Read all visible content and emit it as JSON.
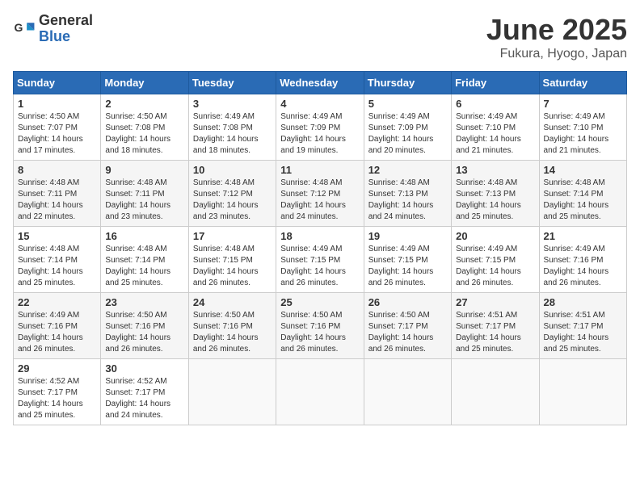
{
  "header": {
    "logo_general": "General",
    "logo_blue": "Blue",
    "month_title": "June 2025",
    "location": "Fukura, Hyogo, Japan"
  },
  "columns": [
    "Sunday",
    "Monday",
    "Tuesday",
    "Wednesday",
    "Thursday",
    "Friday",
    "Saturday"
  ],
  "weeks": [
    [
      {
        "day": "1",
        "sunrise": "4:50 AM",
        "sunset": "7:07 PM",
        "daylight": "14 hours and 17 minutes."
      },
      {
        "day": "2",
        "sunrise": "4:50 AM",
        "sunset": "7:08 PM",
        "daylight": "14 hours and 18 minutes."
      },
      {
        "day": "3",
        "sunrise": "4:49 AM",
        "sunset": "7:08 PM",
        "daylight": "14 hours and 18 minutes."
      },
      {
        "day": "4",
        "sunrise": "4:49 AM",
        "sunset": "7:09 PM",
        "daylight": "14 hours and 19 minutes."
      },
      {
        "day": "5",
        "sunrise": "4:49 AM",
        "sunset": "7:09 PM",
        "daylight": "14 hours and 20 minutes."
      },
      {
        "day": "6",
        "sunrise": "4:49 AM",
        "sunset": "7:10 PM",
        "daylight": "14 hours and 21 minutes."
      },
      {
        "day": "7",
        "sunrise": "4:49 AM",
        "sunset": "7:10 PM",
        "daylight": "14 hours and 21 minutes."
      }
    ],
    [
      {
        "day": "8",
        "sunrise": "4:48 AM",
        "sunset": "7:11 PM",
        "daylight": "14 hours and 22 minutes."
      },
      {
        "day": "9",
        "sunrise": "4:48 AM",
        "sunset": "7:11 PM",
        "daylight": "14 hours and 23 minutes."
      },
      {
        "day": "10",
        "sunrise": "4:48 AM",
        "sunset": "7:12 PM",
        "daylight": "14 hours and 23 minutes."
      },
      {
        "day": "11",
        "sunrise": "4:48 AM",
        "sunset": "7:12 PM",
        "daylight": "14 hours and 24 minutes."
      },
      {
        "day": "12",
        "sunrise": "4:48 AM",
        "sunset": "7:13 PM",
        "daylight": "14 hours and 24 minutes."
      },
      {
        "day": "13",
        "sunrise": "4:48 AM",
        "sunset": "7:13 PM",
        "daylight": "14 hours and 25 minutes."
      },
      {
        "day": "14",
        "sunrise": "4:48 AM",
        "sunset": "7:14 PM",
        "daylight": "14 hours and 25 minutes."
      }
    ],
    [
      {
        "day": "15",
        "sunrise": "4:48 AM",
        "sunset": "7:14 PM",
        "daylight": "14 hours and 25 minutes."
      },
      {
        "day": "16",
        "sunrise": "4:48 AM",
        "sunset": "7:14 PM",
        "daylight": "14 hours and 25 minutes."
      },
      {
        "day": "17",
        "sunrise": "4:48 AM",
        "sunset": "7:15 PM",
        "daylight": "14 hours and 26 minutes."
      },
      {
        "day": "18",
        "sunrise": "4:49 AM",
        "sunset": "7:15 PM",
        "daylight": "14 hours and 26 minutes."
      },
      {
        "day": "19",
        "sunrise": "4:49 AM",
        "sunset": "7:15 PM",
        "daylight": "14 hours and 26 minutes."
      },
      {
        "day": "20",
        "sunrise": "4:49 AM",
        "sunset": "7:15 PM",
        "daylight": "14 hours and 26 minutes."
      },
      {
        "day": "21",
        "sunrise": "4:49 AM",
        "sunset": "7:16 PM",
        "daylight": "14 hours and 26 minutes."
      }
    ],
    [
      {
        "day": "22",
        "sunrise": "4:49 AM",
        "sunset": "7:16 PM",
        "daylight": "14 hours and 26 minutes."
      },
      {
        "day": "23",
        "sunrise": "4:50 AM",
        "sunset": "7:16 PM",
        "daylight": "14 hours and 26 minutes."
      },
      {
        "day": "24",
        "sunrise": "4:50 AM",
        "sunset": "7:16 PM",
        "daylight": "14 hours and 26 minutes."
      },
      {
        "day": "25",
        "sunrise": "4:50 AM",
        "sunset": "7:16 PM",
        "daylight": "14 hours and 26 minutes."
      },
      {
        "day": "26",
        "sunrise": "4:50 AM",
        "sunset": "7:17 PM",
        "daylight": "14 hours and 26 minutes."
      },
      {
        "day": "27",
        "sunrise": "4:51 AM",
        "sunset": "7:17 PM",
        "daylight": "14 hours and 25 minutes."
      },
      {
        "day": "28",
        "sunrise": "4:51 AM",
        "sunset": "7:17 PM",
        "daylight": "14 hours and 25 minutes."
      }
    ],
    [
      {
        "day": "29",
        "sunrise": "4:52 AM",
        "sunset": "7:17 PM",
        "daylight": "14 hours and 25 minutes."
      },
      {
        "day": "30",
        "sunrise": "4:52 AM",
        "sunset": "7:17 PM",
        "daylight": "14 hours and 24 minutes."
      },
      null,
      null,
      null,
      null,
      null
    ]
  ]
}
